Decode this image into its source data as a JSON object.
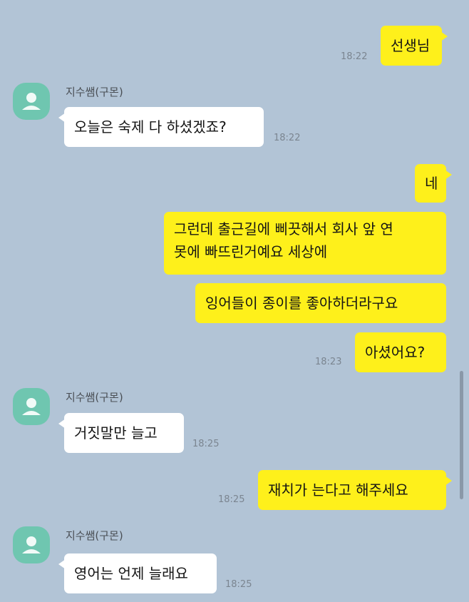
{
  "contact": {
    "name": "지수쌤(구몬)"
  },
  "messages": [
    {
      "from": "me",
      "text": "선생님",
      "time": "18:22"
    },
    {
      "from": "them",
      "text": "오늘은 숙제 다 하셨겠죠?",
      "time": "18:22"
    },
    {
      "from": "me",
      "text": "네"
    },
    {
      "from": "me",
      "line1": "그런데 출근길에 삐끗해서 회사 앞 연",
      "line2": "못에 빠뜨린거예요 세상에"
    },
    {
      "from": "me",
      "text": "잉어들이 종이를 좋아하더라구요"
    },
    {
      "from": "me",
      "text": "아셨어요?",
      "time": "18:23"
    },
    {
      "from": "them",
      "text": "거짓말만 늘고",
      "time": "18:25"
    },
    {
      "from": "me",
      "text": "재치가 는다고 해주세요",
      "time": "18:25"
    },
    {
      "from": "them",
      "text": "영어는 언제 늘래요",
      "time": "18:25"
    }
  ],
  "colors": {
    "background": "#b2c4d6",
    "my_bubble": "#fef01b",
    "their_bubble": "#ffffff",
    "avatar": "#6fc6b0"
  },
  "icons": {
    "avatar": "default-profile-person-icon"
  }
}
